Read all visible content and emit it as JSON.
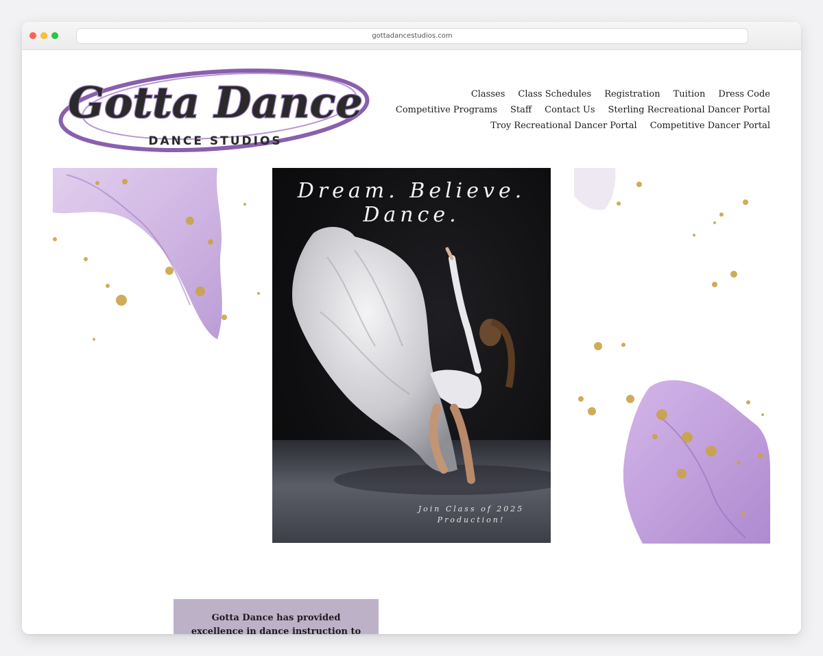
{
  "browser": {
    "url": "gottadancestudios.com"
  },
  "logo": {
    "script_text": "Gotta Dance",
    "subtitle": "DANCE STUDIOS",
    "accent_color": "#8a5fae"
  },
  "nav": {
    "rows": [
      [
        "Classes",
        "Class Schedules",
        "Registration",
        "Tuition",
        "Dress Code"
      ],
      [
        "Competitive Programs",
        "Staff",
        "Contact Us",
        "Sterling Recreational Dancer Portal"
      ],
      [
        "Troy Recreational Dancer Portal",
        "Competitive Dancer Portal"
      ]
    ]
  },
  "hero": {
    "title": "Dream. Believe. Dance.",
    "caption_line1": "Join Class of 2025",
    "caption_line2": "Production!"
  },
  "info": {
    "text": "Gotta Dance has provided excellence in dance instruction to the community since"
  },
  "colors": {
    "lavender": "#b98fd6",
    "gold": "#c9a447",
    "info_box_bg": "#bdb1c8"
  }
}
